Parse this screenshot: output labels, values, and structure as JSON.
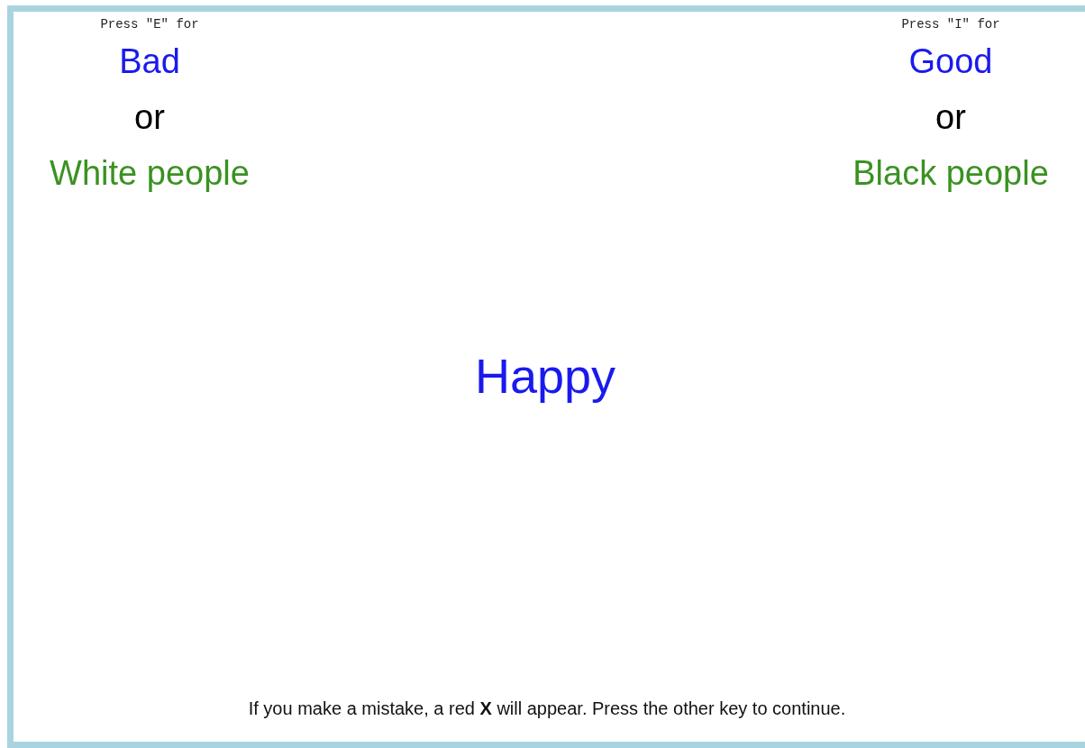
{
  "sides": [
    {
      "key_hint": "Press \"E\" for",
      "lines": [
        {
          "text": "Bad",
          "color": "#1a1aee"
        },
        {
          "text": "or",
          "color": "#000000"
        },
        {
          "text": "White people",
          "color": "#3a9221"
        }
      ]
    },
    {
      "key_hint": "Press \"I\" for",
      "lines": [
        {
          "text": "Good",
          "color": "#1a1aee"
        },
        {
          "text": "or",
          "color": "#000000"
        },
        {
          "text": "Black people",
          "color": "#3a9221"
        }
      ]
    }
  ],
  "stimulus": {
    "text": "Happy",
    "color": "#1a1aee"
  },
  "instructions": "If you make a mistake, a red **X** will appear. Press the other key to continue."
}
